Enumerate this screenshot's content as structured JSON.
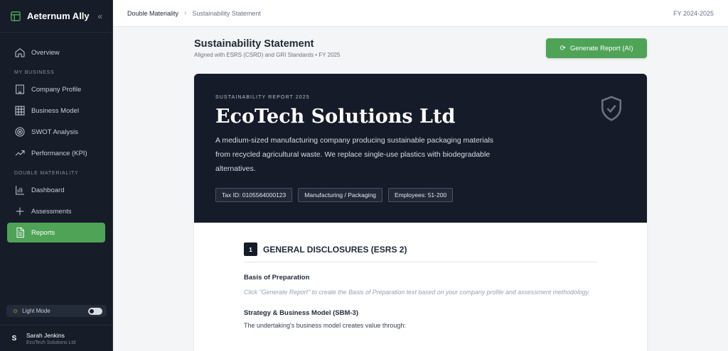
{
  "app": {
    "name": "Aeternum Ally",
    "collapse_glyph": "«"
  },
  "sidebar": {
    "items_top": [
      {
        "label": "Overview",
        "icon": "home-icon"
      }
    ],
    "section_my_business": "MY BUSINESS",
    "items_business": [
      {
        "label": "Company Profile",
        "icon": "building-icon"
      },
      {
        "label": "Business Model",
        "icon": "grid-icon"
      },
      {
        "label": "SWOT Analysis",
        "icon": "target-icon"
      },
      {
        "label": "Performance (KPI)",
        "icon": "trend-up-icon"
      }
    ],
    "section_double_materiality": "DOUBLE MATERIALITY",
    "items_materiality": [
      {
        "label": "Dashboard",
        "icon": "bar-chart-icon"
      },
      {
        "label": "Assessments",
        "icon": "plus-icon"
      },
      {
        "label": "Reports",
        "icon": "document-icon",
        "active": true
      }
    ],
    "theme_label": "Light Mode",
    "user": {
      "initial": "S",
      "name": "Sarah Jenkins",
      "company": "EcoTech Solutions Ltd"
    }
  },
  "topbar": {
    "breadcrumb": [
      "Double Materiality",
      "Sustainability Statement"
    ],
    "fiscal_year": "FY 2024-2025"
  },
  "page": {
    "title": "Sustainability Statement",
    "subtitle": "Aligned with ESRS (CSRD) and GRI Standards • FY 2025",
    "generate_button": "Generate Report (AI)"
  },
  "report": {
    "eyebrow": "SUSTAINABILITY REPORT 2025",
    "company": "EcoTech Solutions Ltd",
    "description": "A medium-sized manufacturing company producing sustainable packaging materials from recycled agricultural waste. We replace single-use plastics with biodegradable alternatives.",
    "badges": [
      "Tax ID: 0105564000123",
      "Manufacturing / Packaging",
      "Employees: 51-200"
    ],
    "section": {
      "number": "1",
      "title": "GENERAL DISCLOSURES (ESRS 2)",
      "basis_heading": "Basis of Preparation",
      "basis_placeholder": "Click \"Generate Report\" to create the Basis of Preparation text based on your company profile and assessment methodology.",
      "strategy_heading": "Strategy & Business Model (SBM-3)",
      "strategy_text": "The undertaking's business model creates value through:"
    }
  },
  "colors": {
    "sidebar_bg": "#161c28",
    "accent_green": "#4ea357",
    "hero_bg": "#161b29",
    "avatar_bg": "#161c28"
  }
}
